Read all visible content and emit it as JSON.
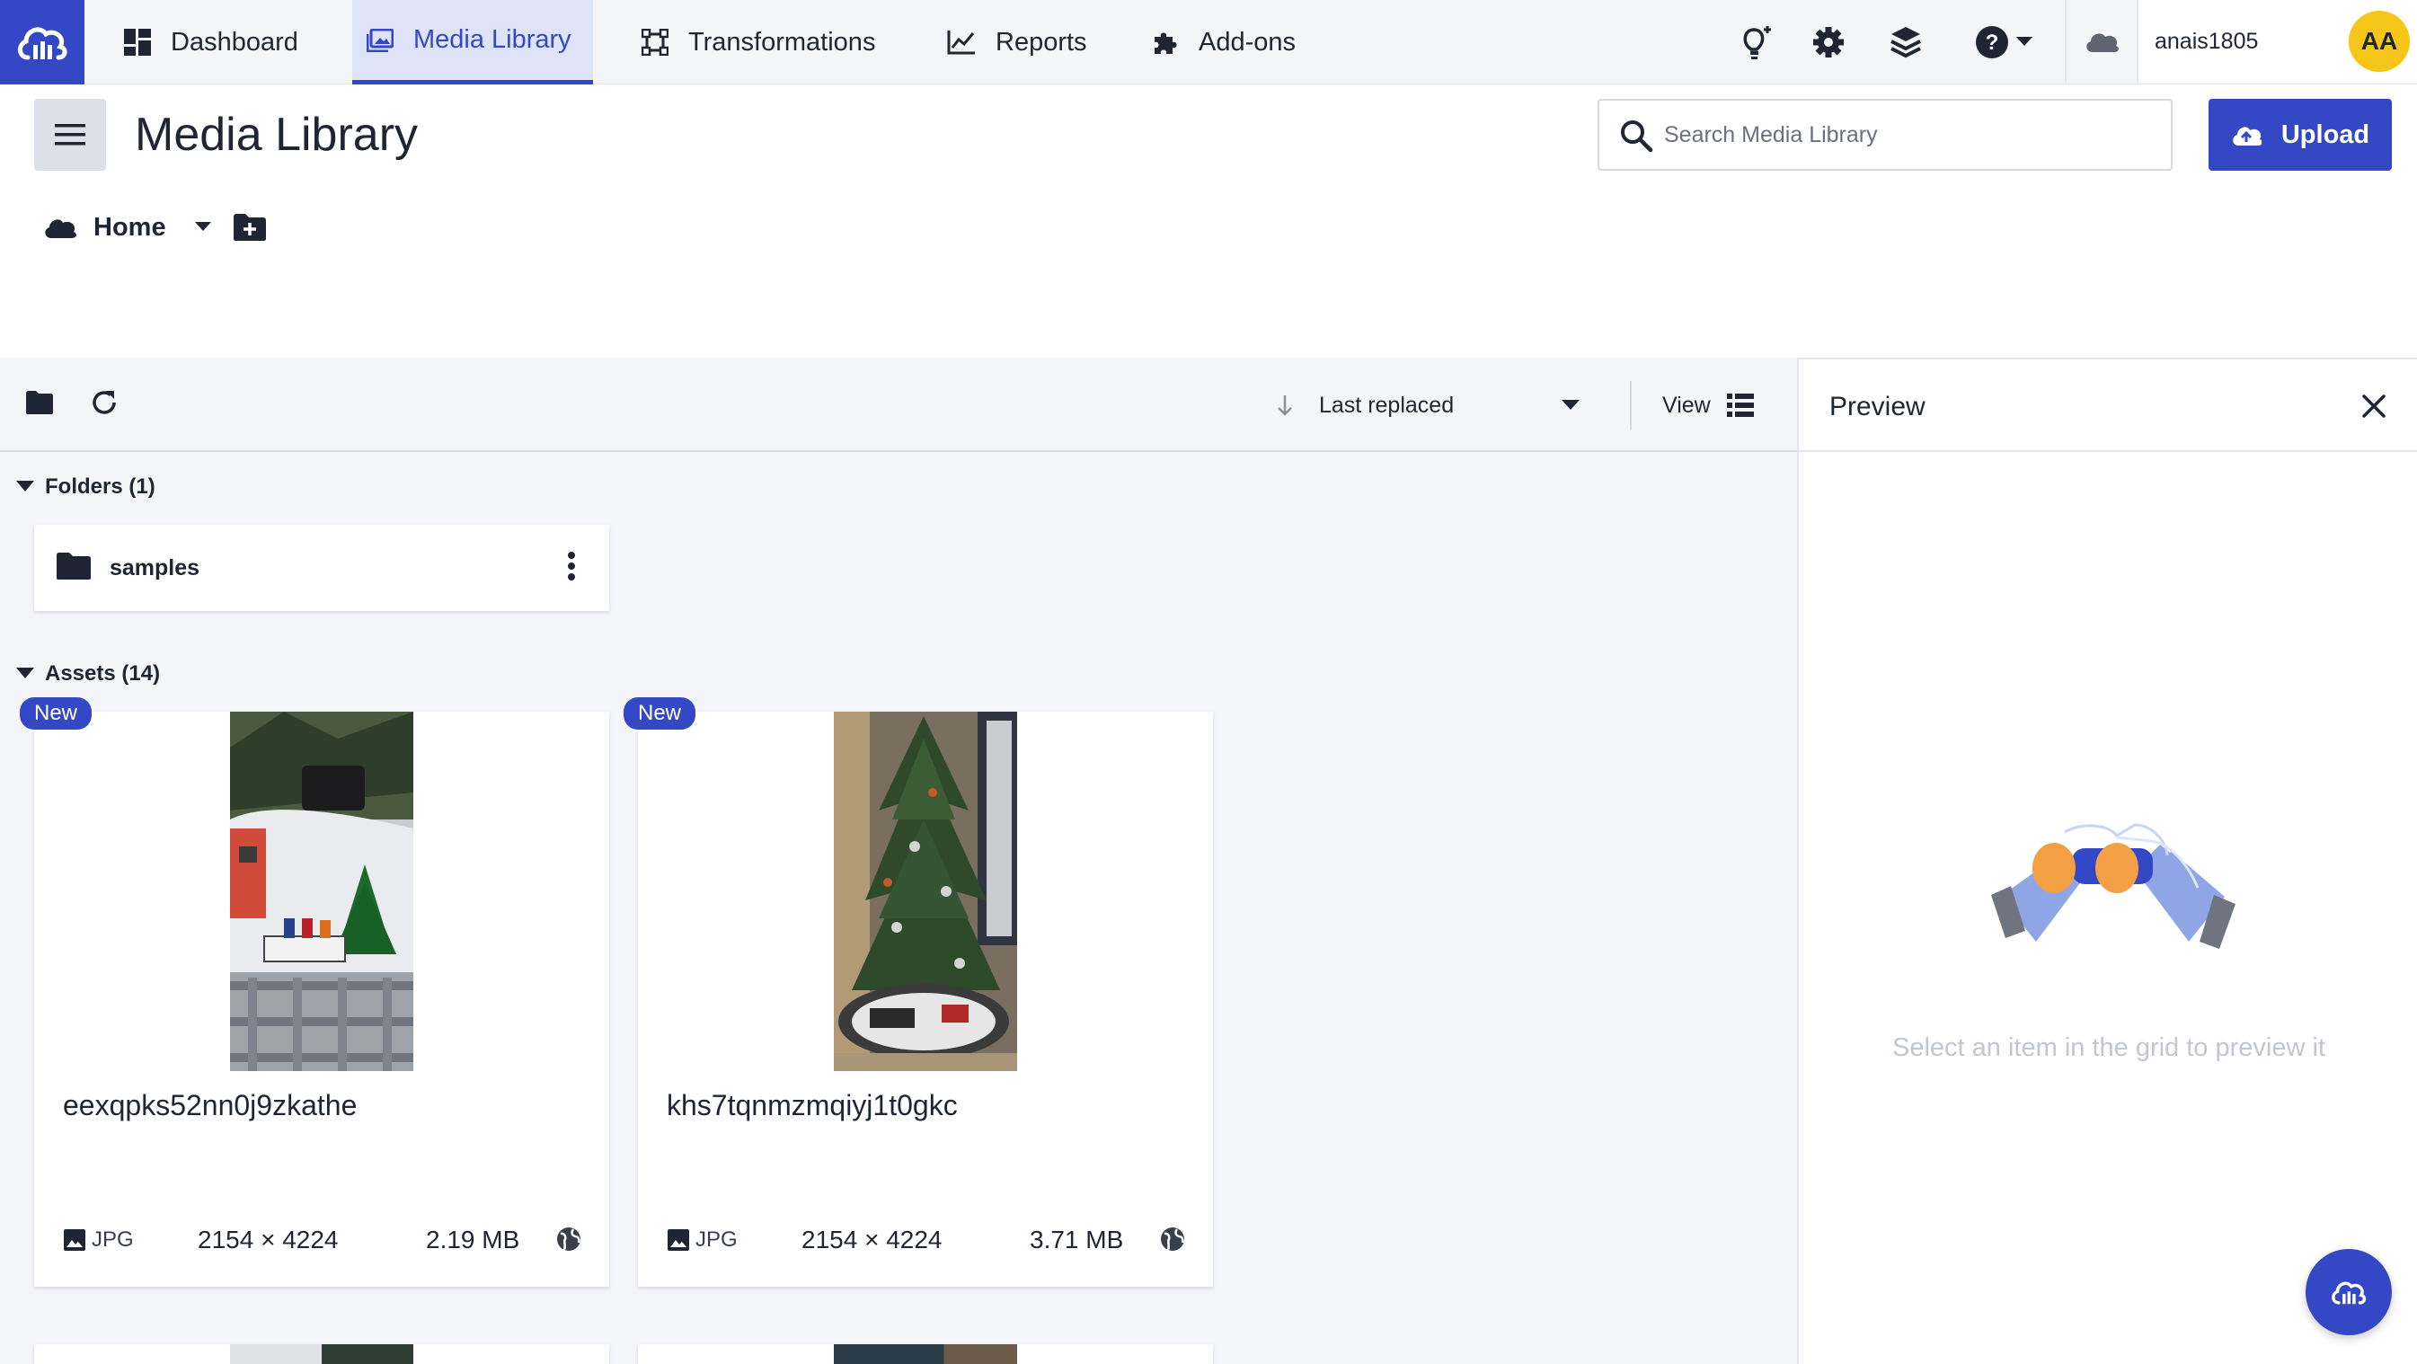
{
  "nav": {
    "items": [
      {
        "label": "Dashboard",
        "icon": "dashboard-icon"
      },
      {
        "label": "Media Library",
        "icon": "media-library-icon",
        "active": true
      },
      {
        "label": "Transformations",
        "icon": "transformations-icon"
      },
      {
        "label": "Reports",
        "icon": "reports-icon"
      },
      {
        "label": "Add-ons",
        "icon": "puzzle-icon"
      }
    ],
    "account": {
      "username": "anais1805",
      "initials": "AA"
    }
  },
  "header": {
    "title": "Media Library",
    "search_placeholder": "Search Media Library",
    "upload_label": "Upload"
  },
  "breadcrumb": {
    "home_label": "Home"
  },
  "toolbar": {
    "sort_label": "Last replaced",
    "view_label": "View"
  },
  "folders": {
    "heading": "Folders (1)",
    "items": [
      {
        "name": "samples"
      }
    ]
  },
  "assets": {
    "heading": "Assets (14)",
    "items": [
      {
        "badge": "New",
        "name": "eexqpks52nn0j9zkathe",
        "format": "JPG",
        "dimensions": "2154 × 4224",
        "size": "2.19 MB"
      },
      {
        "badge": "New",
        "name": "khs7tqnmzmqiyj1t0gkc",
        "format": "JPG",
        "dimensions": "2154 × 4224",
        "size": "3.71 MB"
      }
    ]
  },
  "preview": {
    "title": "Preview",
    "empty_message": "Select an item in the grid to preview it"
  },
  "colors": {
    "accent": "#3448c5",
    "avatar": "#f5c518",
    "nav_bg": "#f4f5f8"
  }
}
